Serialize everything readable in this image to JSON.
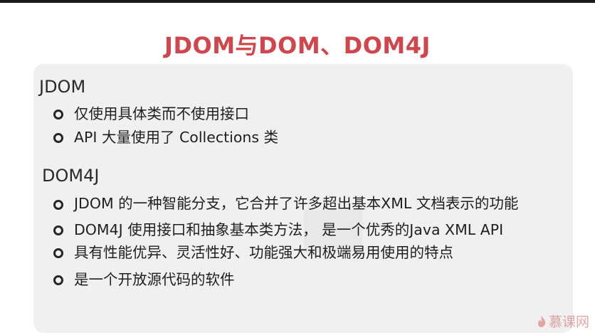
{
  "slide": {
    "title": "JDOM与DOM、DOM4J"
  },
  "sections": {
    "jdom": {
      "heading": "JDOM",
      "items": [
        "仅使用具体类而不使用接口",
        "API 大量使用了 Collections 类"
      ]
    },
    "dom4j": {
      "heading": "DOM4J",
      "items": [
        "JDOM 的一种智能分支，它合并了许多超出基本XML 文档表示的功能",
        "DOM4J 使用接口和抽象基本类方法， 是一个优秀的Java XML API",
        "具有性能优异、灵活性好、功能强大和极端易用使用的特点",
        "是一个开放源代码的软件"
      ]
    }
  },
  "watermark": {
    "text": "慕课网"
  },
  "colors": {
    "title": "#d1454c",
    "panel": "#f1f0f1",
    "text": "#1f1f1f",
    "top_bar": "#1b1b1b"
  }
}
